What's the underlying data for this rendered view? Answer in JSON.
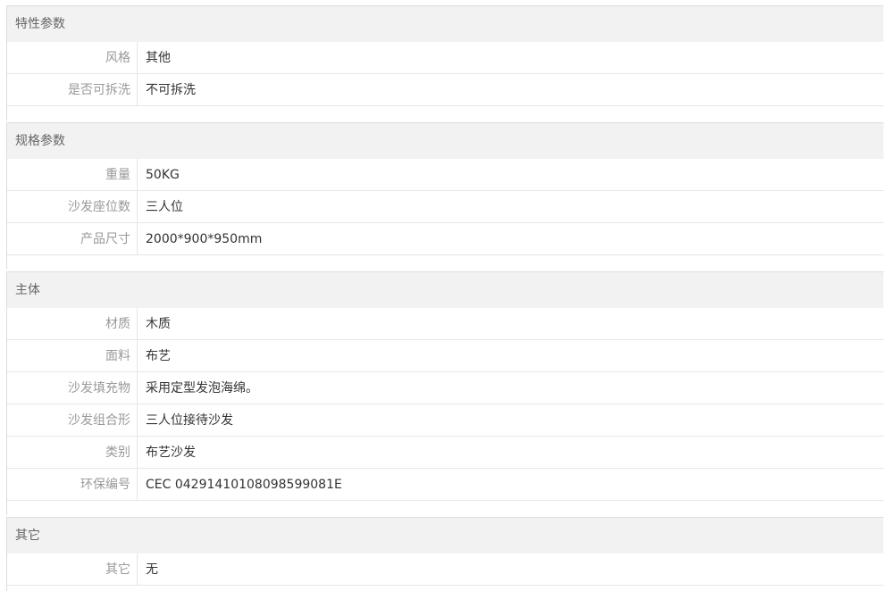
{
  "sections": [
    {
      "title": "特性参数",
      "rows": [
        {
          "label": "风格",
          "value": "其他"
        },
        {
          "label": "是否可拆洗",
          "value": "不可拆洗"
        }
      ]
    },
    {
      "title": "规格参数",
      "rows": [
        {
          "label": "重量",
          "value": "50KG"
        },
        {
          "label": "沙发座位数",
          "value": "三人位"
        },
        {
          "label": "产品尺寸",
          "value": "2000*900*950mm"
        }
      ]
    },
    {
      "title": "主体",
      "rows": [
        {
          "label": "材质",
          "value": "木质"
        },
        {
          "label": "面料",
          "value": "布艺"
        },
        {
          "label": "沙发填充物",
          "value": "采用定型发泡海绵。"
        },
        {
          "label": "沙发组合形",
          "value": "三人位接待沙发"
        },
        {
          "label": "类别",
          "value": "布艺沙发"
        },
        {
          "label": "环保编号",
          "value": "CEC 04291410108098599081E"
        }
      ]
    },
    {
      "title": "其它",
      "rows": [
        {
          "label": "其它",
          "value": "无"
        }
      ]
    }
  ]
}
